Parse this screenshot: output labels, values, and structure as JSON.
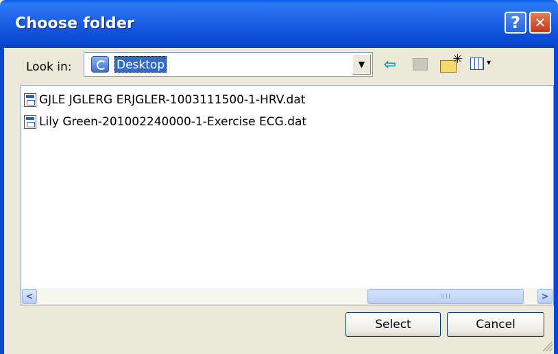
{
  "window": {
    "title": "Choose folder",
    "help_glyph": "?",
    "close_glyph": "✕"
  },
  "toolbar": {
    "look_in_label": "Look in:",
    "look_in_value": "Desktop",
    "dropdown_glyph": "▼",
    "back_glyph": "⇦",
    "view_menu_glyph": "▾"
  },
  "files": [
    {
      "name": "GJLE JGLERG ERJGLER-1003111500-1-HRV.dat",
      "icon": "dat-file-icon"
    },
    {
      "name": "Lily Green-201002240000-1-Exercise ECG.dat",
      "icon": "dat-file-icon"
    }
  ],
  "scrollbar": {
    "left_glyph": "<",
    "right_glyph": ">",
    "thumb_grip": "IIII"
  },
  "buttons": {
    "select_label": "Select",
    "cancel_label": "Cancel"
  }
}
